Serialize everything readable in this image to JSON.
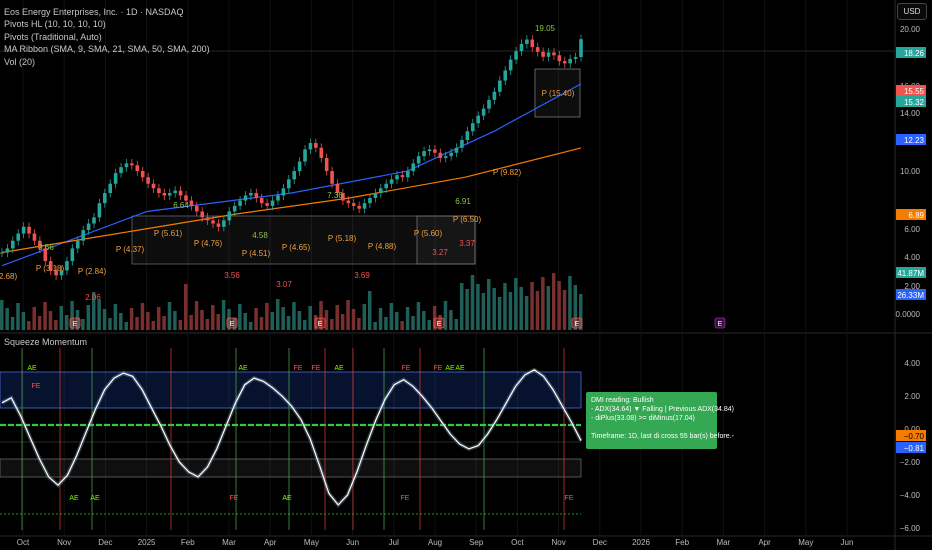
{
  "legend": {
    "title": "Eos Energy Enterprises, Inc. · 1D · NASDAQ",
    "lines": [
      "Pivots HL (10, 10, 10, 10)",
      "Pivots (Traditional, Auto)",
      "MA Ribbon (SMA, 9, SMA, 21, SMA, 50, SMA, 200)",
      "Vol (20)"
    ]
  },
  "currency": "USD",
  "price_axis": {
    "ticks": [
      "20.00",
      "16.00",
      "14.00",
      "10.00",
      "6.00",
      "4.00",
      "2.00",
      "0.0000"
    ],
    "badges": [
      {
        "value": "18.26",
        "color": "#26a69a"
      },
      {
        "value": "15.55",
        "color": "#ef5350"
      },
      {
        "value": "15.32",
        "color": "#26a69a"
      },
      {
        "value": "12.23",
        "color": "#2962ff"
      },
      {
        "value": "6.89",
        "color": "#f57c00"
      },
      {
        "value": "41.87M",
        "color": "#26a69a"
      },
      {
        "value": "26.33M",
        "color": "#2962ff"
      }
    ]
  },
  "osc_axis": {
    "ticks": [
      "4.00",
      "2.00",
      "0.00",
      "−2.00",
      "−4.00",
      "−6.00"
    ],
    "badges": [
      {
        "value": "−0.70",
        "color": "#f57c00",
        "text": "#000"
      },
      {
        "value": "−0.81",
        "color": "#2962ff",
        "text": "#fff"
      }
    ]
  },
  "time_axis": [
    "Oct",
    "Nov",
    "Dec",
    "2025",
    "Feb",
    "Mar",
    "Apr",
    "May",
    "Jun",
    "Jul",
    "Aug",
    "Sep",
    "Oct",
    "Nov",
    "Dec",
    "2026",
    "Feb",
    "Mar",
    "Apr",
    "May",
    "Jun"
  ],
  "price_annotations": {
    "highs": [
      "3.66",
      "6.64",
      "4.58",
      "7.36",
      "6.91",
      "19.05"
    ],
    "lows": [
      "2.06",
      "3.56",
      "3.07",
      "3.69",
      "3.27",
      "3.37"
    ],
    "pivots": [
      "P (4.37)",
      "P (5.61)",
      "P (4.76)",
      "P (4.51)",
      "P (4.65)",
      "P (5.18)",
      "P (4.88)",
      "P (5.60)",
      "P (6.50)",
      "P (9.82)",
      "P (15.40)"
    ],
    "left_cut": [
      "2.68)",
      "P (3.18)",
      "P (2.84)"
    ]
  },
  "squeeze": {
    "title": "Squeeze Momentum",
    "markers": [
      "FE",
      "AE",
      "AE",
      "FE",
      "AE",
      "AE",
      "FE",
      "FE",
      "AE",
      "FE",
      "FE",
      "AE",
      "AE",
      "FE",
      "AE",
      "FE"
    ]
  },
  "dmi": {
    "lines": [
      "DMI reading:   Bullish",
      "- ADX(34.64) ▼ Falling | Previous ADX(34.84)",
      "- diPlus(33.08) >= diMinus(17.04)",
      "",
      "Timeframe: 1D, last di cross 55 bar(s) before.-"
    ]
  },
  "chart_data": {
    "type": "line",
    "title": "Eos Energy Enterprises, Inc. · 1D · NASDAQ",
    "x_range": [
      "2024-09-27",
      "2026-06-15"
    ],
    "y_range": [
      0,
      20
    ],
    "closes": [
      2.7,
      2.8,
      3.0,
      3.2,
      3.4,
      3.2,
      3.0,
      2.8,
      2.5,
      2.3,
      2.2,
      2.3,
      2.5,
      2.8,
      3.0,
      3.3,
      3.5,
      3.7,
      4.2,
      4.6,
      5.0,
      5.5,
      5.8,
      6.0,
      5.9,
      5.6,
      5.3,
      5.0,
      4.8,
      4.6,
      4.5,
      4.6,
      4.7,
      4.5,
      4.3,
      4.1,
      3.9,
      3.7,
      3.6,
      3.5,
      3.4,
      3.6,
      3.9,
      4.1,
      4.3,
      4.5,
      4.6,
      4.4,
      4.2,
      4.1,
      4.3,
      4.5,
      4.8,
      5.2,
      5.6,
      6.1,
      6.8,
      7.2,
      6.9,
      6.3,
      5.6,
      5.0,
      4.6,
      4.3,
      4.2,
      4.1,
      4.0,
      4.2,
      4.4,
      4.6,
      4.8,
      5.0,
      5.2,
      5.4,
      5.3,
      5.6,
      6.0,
      6.4,
      6.7,
      6.8,
      6.6,
      6.3,
      6.4,
      6.6,
      6.9,
      7.4,
      8.0,
      8.6,
      9.2,
      9.8,
      10.6,
      11.4,
      12.6,
      13.8,
      15.2,
      16.4,
      17.5,
      18.2,
      17.0,
      16.3,
      15.6,
      16.2,
      15.8,
      15.0,
      14.7,
      15.3,
      15.55,
      18.26
    ],
    "ma_ribbon": [
      {
        "name": "SMA 50",
        "color": "#2962ff",
        "values": [
          [
            0,
            2.4
          ],
          [
            0.25,
            3.9
          ],
          [
            0.5,
            4.6
          ],
          [
            0.7,
            5.6
          ],
          [
            0.85,
            8.0
          ],
          [
            1,
            12.23
          ]
        ]
      },
      {
        "name": "SMA 200",
        "color": "#f57c00",
        "values": [
          [
            0,
            2.7
          ],
          [
            0.2,
            3.2
          ],
          [
            0.4,
            3.8
          ],
          [
            0.6,
            4.4
          ],
          [
            0.8,
            5.3
          ],
          [
            1,
            6.89
          ]
        ]
      }
    ],
    "pivots_hl": {
      "highs": [
        3.66,
        6.64,
        4.58,
        7.36,
        6.91,
        19.05
      ],
      "lows": [
        2.06,
        3.56,
        3.07,
        3.69,
        3.27,
        3.37
      ]
    },
    "last_values": {
      "price": 18.26,
      "open": 15.55,
      "prev": 15.32,
      "sma50": 12.23,
      "sma200": 6.89,
      "volume_m": 41.87,
      "volume_ma_m": 26.33
    },
    "oscillator": {
      "y_range": [
        -6,
        4.5
      ],
      "last": [
        -0.7,
        -0.81
      ],
      "values": [
        1.6,
        1.9,
        0.8,
        -0.5,
        -1.8,
        -2.9,
        -3.4,
        -2.8,
        -1.6,
        -0.2,
        1.2,
        2.4,
        3.1,
        3.4,
        3.2,
        2.4,
        1.3,
        0.2,
        -1.0,
        -2.0,
        -2.6,
        -2.9,
        -2.3,
        -1.2,
        0.2,
        1.6,
        2.7,
        3.1,
        2.9,
        2.5,
        2.0,
        1.4,
        0.6,
        -0.6,
        -2.2,
        -3.9,
        -4.6,
        -4.0,
        -2.6,
        -1.0,
        0.5,
        1.8,
        2.7,
        3.0,
        2.6,
        2.0,
        1.3,
        0.5,
        -0.3,
        -0.9,
        -1.2,
        -1.0,
        -0.3,
        0.6,
        1.6,
        2.6,
        3.3,
        3.6,
        3.2,
        2.4,
        1.4,
        0.4,
        -0.7
      ]
    }
  }
}
